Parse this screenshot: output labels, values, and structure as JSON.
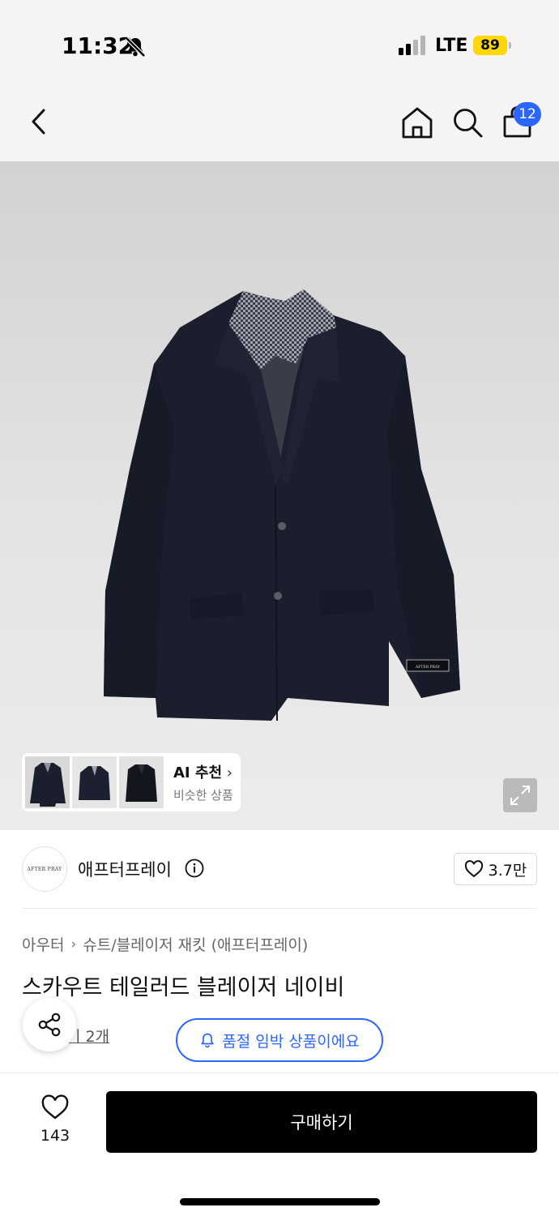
{
  "status_bar": {
    "time": "11:32",
    "network": "LTE",
    "battery": "89"
  },
  "nav": {
    "back_icon": "chevron-left-icon",
    "home_icon": "home-icon",
    "search_icon": "search-icon",
    "cart_icon": "shopping-bag-icon",
    "cart_count": "12"
  },
  "gallery": {
    "ai_title": "AI 추천",
    "ai_subtitle": "비슷한 상품",
    "thumbnails": [
      "jacket-front",
      "jacket-flat",
      "jacket-worn"
    ]
  },
  "brand": {
    "logo_text": "AFTER PRAY",
    "name": "애프터프레이",
    "likes": "3.7만"
  },
  "product": {
    "breadcrumb": [
      "아우터",
      "슈트/블레이저 재킷 (애프터프레이)"
    ],
    "title": "스카우트 테일러드 블레이저 네이비",
    "review_link": "기 2개",
    "stock_notice": "품절 임박 상품이에요"
  },
  "bottom_bar": {
    "wish_count": "143",
    "buy_label": "구매하기"
  },
  "colors": {
    "accent": "#2a66ff",
    "buy_button": "#000000",
    "battery": "#ffd60a"
  }
}
